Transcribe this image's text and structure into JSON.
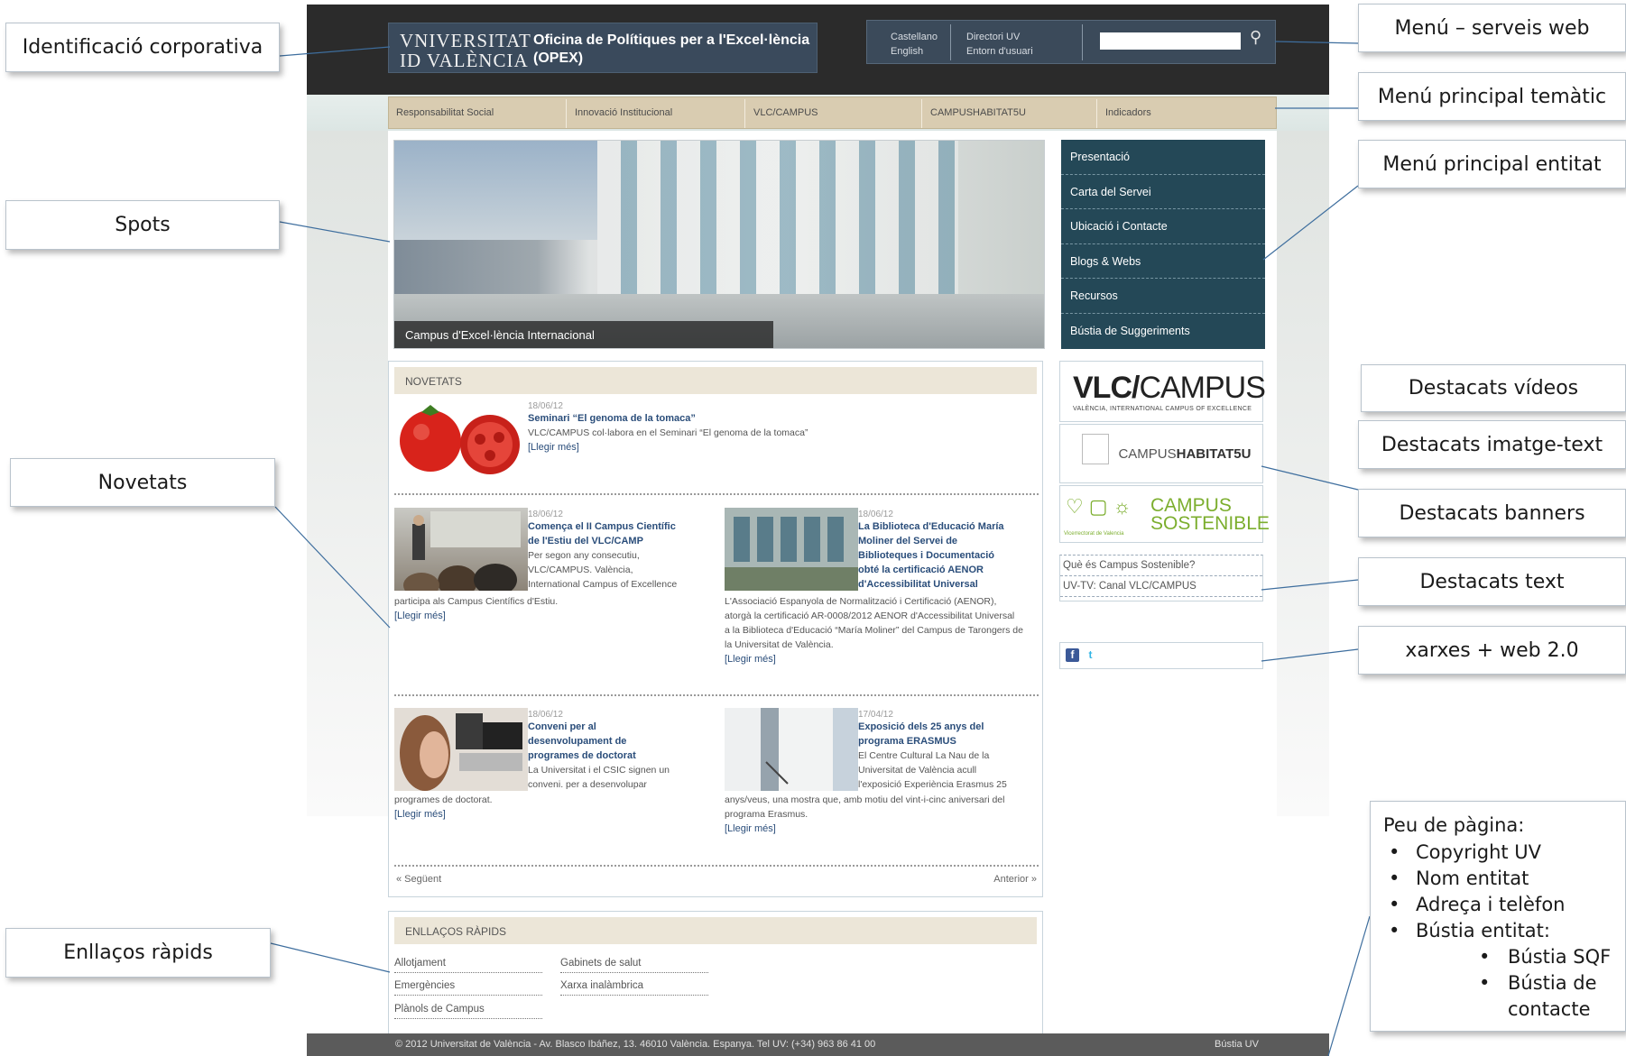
{
  "callouts": {
    "corporate_id": "Identificació corporativa",
    "web_services_menu": "Menú – serveis web",
    "thematic_menu": "Menú principal  temàtic",
    "entity_menu": "Menú principal entitat",
    "spots": "Spots",
    "video_highlights": "Destacats vídeos",
    "image_text_highlights": "Destacats imatge-text",
    "banner_highlights": "Destacats banners",
    "text_highlights": "Destacats text",
    "news": "Novetats",
    "social": "xarxes + web 2.0",
    "quick_links": "Enllaços ràpids",
    "footer": {
      "title": "Peu de pàgina:",
      "items": [
        "Copyright UV",
        "Nom entitat",
        "Adreça i telèfon",
        "Bústia entitat:"
      ],
      "subitems": [
        "Bústia SQF",
        "Bústia de",
        "contacte"
      ]
    }
  },
  "site": {
    "logo_line1": "VNIVERSITAT",
    "logo_line2": "ID VALÈNCIA",
    "office_line1": "Oficina de Polítiques per a l'Excel·lència",
    "office_line2": "(OPEX)",
    "services": {
      "lang1": "Castellano",
      "lang2": "English",
      "link1": "Directori UV",
      "link2": "Entorn d'usuari",
      "search_placeholder": ""
    },
    "main_nav": [
      "Responsabilitat Social",
      "Innovació Institucional",
      "VLC/CAMPUS",
      "CAMPUSHABITAT5U",
      "Indicadors"
    ],
    "spot_caption": "Campus d'Excel·lència Internacional",
    "entity_menu": [
      "Presentació",
      "Carta del Servei",
      "Ubicació i Contacte",
      "Blogs & Webs",
      "Recursos",
      "Bústia de Suggeriments"
    ],
    "news_heading": "NOVETATS",
    "news": [
      {
        "date": "18/06/12",
        "title": "Seminari “El genoma de la tomaca”",
        "text": "VLC/CAMPUS col·labora en el Seminari “El genoma de la tomaca”",
        "more": "[Llegir més]"
      },
      {
        "date": "18/06/12",
        "title_lines": [
          "Comença el II Campus Científic",
          "de l'Estiu del VLC/CAMP"
        ],
        "text_lines": [
          "Per segon any consecutiu,",
          "VLC/CAMPUS. València,",
          "International Campus of Excellence"
        ],
        "tail": "participa als Campus Científics d'Estiu.",
        "more": "[Llegir més]"
      },
      {
        "date": "18/06/12",
        "title_lines": [
          "La Biblioteca d'Educació María",
          "Moliner del Servei de",
          "Biblioteques i Documentació",
          "obté la certificació AENOR",
          "d'Accessibilitat Universal"
        ],
        "tail_lines": [
          "L'Associació Espanyola de Normalització i Certificació (AENOR),",
          "atorgà la certificació AR-0008/2012 AENOR d'Accessibilitat Universal",
          "a la Biblioteca d'Educació “María Moliner” del Campus de Tarongers de",
          "la Universitat de València."
        ],
        "more": "[Llegir més]"
      },
      {
        "date": "18/06/12",
        "title_lines": [
          "Conveni per al",
          "desenvolupament de",
          "programes de doctorat"
        ],
        "text_lines": [
          "La Universitat i el CSIC signen un",
          "conveni. per a desenvolupar"
        ],
        "tail": "programes de doctorat.",
        "more": "[Llegir més]"
      },
      {
        "date": "17/04/12",
        "title_lines": [
          "Exposició dels 25 anys del",
          "programa ERASMUS"
        ],
        "text_lines": [
          "El Centre Cultural La Nau de la",
          "Universitat de València acull",
          "l'exposició Experiència Erasmus 25"
        ],
        "tail_lines": [
          "anys/veus, una mostra que, amb motiu del vint-i-cinc aniversari del",
          "programa Erasmus."
        ],
        "more": "[Llegir més]"
      }
    ],
    "pager_next": "«  Següent",
    "pager_prev": "Anterior  »",
    "quick_heading": "ENLLAÇOS RÀPIDS",
    "quick_links": [
      "Allotjament",
      "Emergències",
      "Plànols de Campus",
      "Gabinets de salut",
      "Xarxa inalàmbrica"
    ],
    "vlc_logo_a": "VLC/",
    "vlc_logo_b": "CAMPUS",
    "vlc_logo_sub": "VALÈNCIA, INTERNATIONAL CAMPUS OF EXCELLENCE",
    "hab_logo_a": "CAMPUS",
    "hab_logo_b": "HABITAT5U",
    "sost_line1": "CAMPUS",
    "sost_line2": "SOSTENIBLE",
    "sost_small": "Vicerrectorat de Valencia",
    "text_links": [
      "Què és Campus Sostenible?",
      "UV-TV: Canal VLC/CAMPUS"
    ],
    "social_fb": "f",
    "social_tw": "t",
    "footer_text": "© 2012 Universitat de València - Av. Blasco Ibáñez, 13. 46010 València. Espanya. Tel UV: (+34) 963 86 41 00",
    "footer_link": "Bústia UV"
  },
  "colors": {
    "header_dark": "#2b2b2b",
    "logo_box": "#3a4a5c",
    "nav_tan": "#d9ccb1",
    "entity_menu": "#244857",
    "link_blue": "#2a4d7a",
    "leader_line": "#3e6e9e"
  }
}
